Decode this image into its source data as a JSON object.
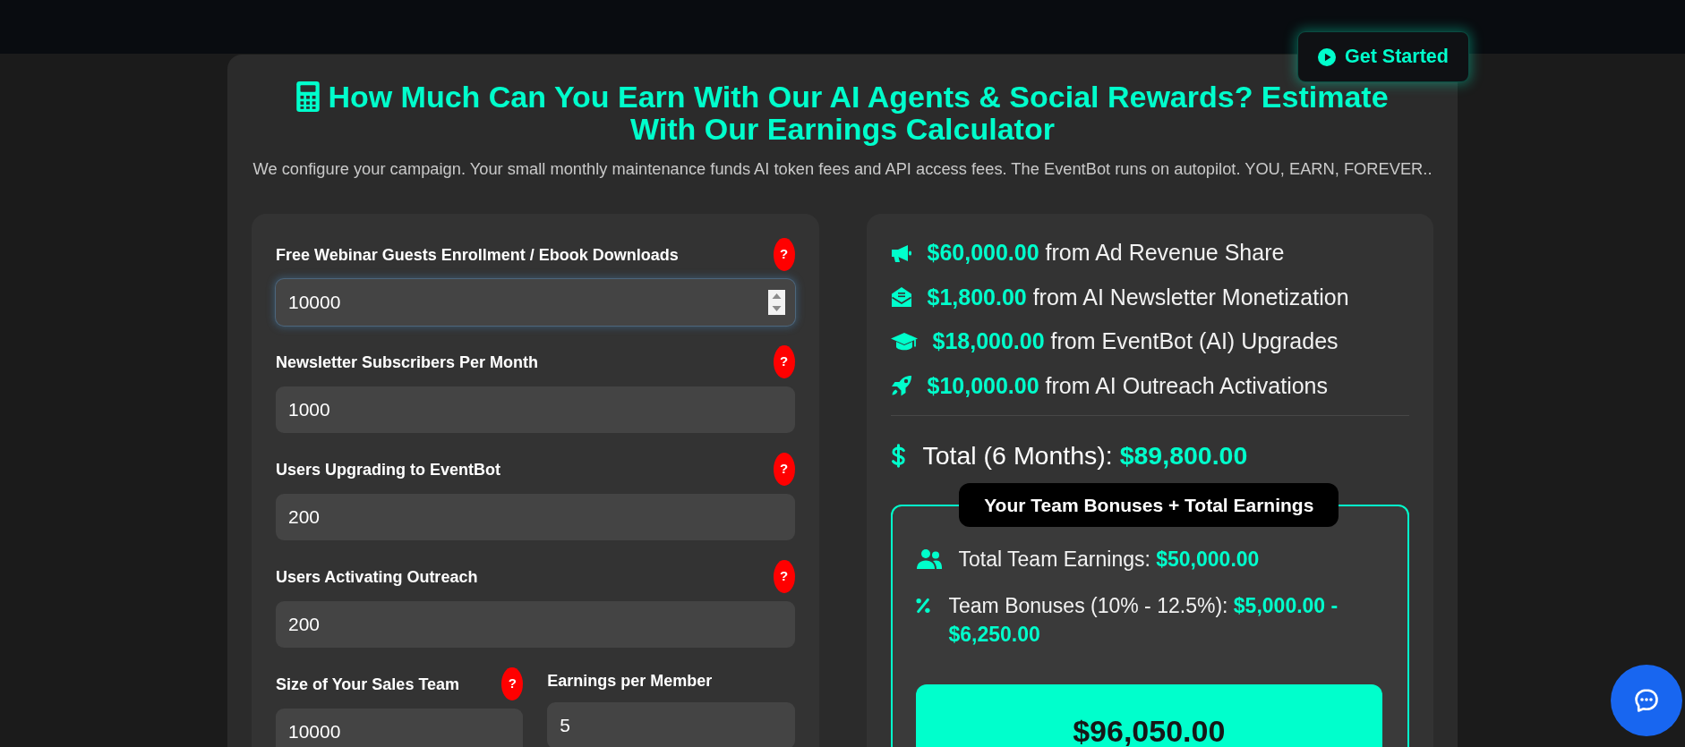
{
  "top_bar": {
    "button": {
      "label": "Get Started"
    }
  },
  "calculator": {
    "title": "How Much Can You Earn With Our AI Agents & Social Rewards? Estimate With Our Earnings Calculator",
    "subtitle": "We configure your campaign. Your small monthly maintenance funds AI token fees and API access fees. The EventBot runs on autopilot. YOU, EARN, FOREVER.."
  },
  "form": {
    "fields": [
      {
        "label": "Free Webinar Guests Enrollment / Ebook Downloads",
        "help": "?",
        "value": "10000",
        "focused": true
      },
      {
        "label": "Newsletter Subscribers Per Month",
        "help": "?",
        "value": "1000",
        "focused": false
      },
      {
        "label": "Users Upgrading to EventBot",
        "help": "?",
        "value": "200",
        "focused": false
      },
      {
        "label": "Users Activating Outreach",
        "help": "?",
        "value": "200",
        "focused": false
      }
    ],
    "team_fields": [
      {
        "label": "Size of Your Sales Team",
        "help": "?",
        "value": "10000",
        "focused": false
      },
      {
        "label": "Earnings per Member",
        "value": "5",
        "focused": false
      }
    ]
  },
  "results": {
    "sources": [
      "**$60,000.00** from Ad Revenue Share",
      "**$1,800.00** from AI Newsletter Monetization",
      "**$18,000.00** from EventBot (AI) Upgrades",
      "**$10,000.00** from AI Outreach Activations"
    ],
    "total": "Total (6 Months): **$89,800.00**",
    "team": {
      "legend": "Your Team Bonuses + Total Earnings",
      "rows": [
        "Total Team Earnings: **$50,000.00**",
        "Team Bonuses (10% - 12.5%): **$5,000.00 - $6,250.00**"
      ],
      "grand_total": "$96,050.00"
    }
  }
}
